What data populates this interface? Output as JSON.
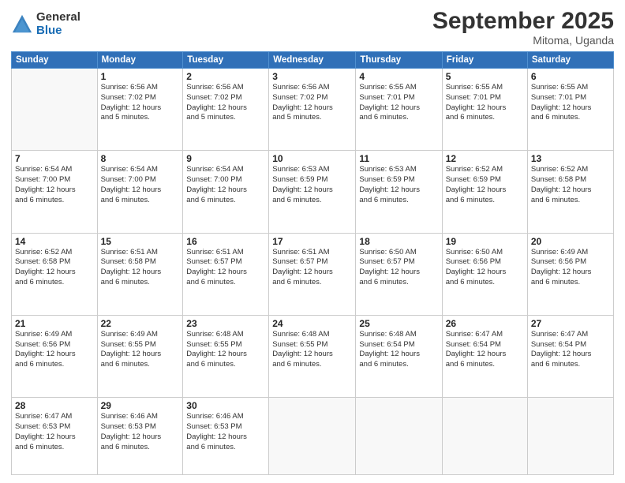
{
  "logo": {
    "general": "General",
    "blue": "Blue"
  },
  "header": {
    "month": "September 2025",
    "location": "Mitoma, Uganda"
  },
  "days_of_week": [
    "Sunday",
    "Monday",
    "Tuesday",
    "Wednesday",
    "Thursday",
    "Friday",
    "Saturday"
  ],
  "weeks": [
    [
      {
        "num": "",
        "info": ""
      },
      {
        "num": "1",
        "info": "Sunrise: 6:56 AM\nSunset: 7:02 PM\nDaylight: 12 hours\nand 5 minutes."
      },
      {
        "num": "2",
        "info": "Sunrise: 6:56 AM\nSunset: 7:02 PM\nDaylight: 12 hours\nand 5 minutes."
      },
      {
        "num": "3",
        "info": "Sunrise: 6:56 AM\nSunset: 7:02 PM\nDaylight: 12 hours\nand 5 minutes."
      },
      {
        "num": "4",
        "info": "Sunrise: 6:55 AM\nSunset: 7:01 PM\nDaylight: 12 hours\nand 6 minutes."
      },
      {
        "num": "5",
        "info": "Sunrise: 6:55 AM\nSunset: 7:01 PM\nDaylight: 12 hours\nand 6 minutes."
      },
      {
        "num": "6",
        "info": "Sunrise: 6:55 AM\nSunset: 7:01 PM\nDaylight: 12 hours\nand 6 minutes."
      }
    ],
    [
      {
        "num": "7",
        "info": "Sunrise: 6:54 AM\nSunset: 7:00 PM\nDaylight: 12 hours\nand 6 minutes."
      },
      {
        "num": "8",
        "info": "Sunrise: 6:54 AM\nSunset: 7:00 PM\nDaylight: 12 hours\nand 6 minutes."
      },
      {
        "num": "9",
        "info": "Sunrise: 6:54 AM\nSunset: 7:00 PM\nDaylight: 12 hours\nand 6 minutes."
      },
      {
        "num": "10",
        "info": "Sunrise: 6:53 AM\nSunset: 6:59 PM\nDaylight: 12 hours\nand 6 minutes."
      },
      {
        "num": "11",
        "info": "Sunrise: 6:53 AM\nSunset: 6:59 PM\nDaylight: 12 hours\nand 6 minutes."
      },
      {
        "num": "12",
        "info": "Sunrise: 6:52 AM\nSunset: 6:59 PM\nDaylight: 12 hours\nand 6 minutes."
      },
      {
        "num": "13",
        "info": "Sunrise: 6:52 AM\nSunset: 6:58 PM\nDaylight: 12 hours\nand 6 minutes."
      }
    ],
    [
      {
        "num": "14",
        "info": "Sunrise: 6:52 AM\nSunset: 6:58 PM\nDaylight: 12 hours\nand 6 minutes."
      },
      {
        "num": "15",
        "info": "Sunrise: 6:51 AM\nSunset: 6:58 PM\nDaylight: 12 hours\nand 6 minutes."
      },
      {
        "num": "16",
        "info": "Sunrise: 6:51 AM\nSunset: 6:57 PM\nDaylight: 12 hours\nand 6 minutes."
      },
      {
        "num": "17",
        "info": "Sunrise: 6:51 AM\nSunset: 6:57 PM\nDaylight: 12 hours\nand 6 minutes."
      },
      {
        "num": "18",
        "info": "Sunrise: 6:50 AM\nSunset: 6:57 PM\nDaylight: 12 hours\nand 6 minutes."
      },
      {
        "num": "19",
        "info": "Sunrise: 6:50 AM\nSunset: 6:56 PM\nDaylight: 12 hours\nand 6 minutes."
      },
      {
        "num": "20",
        "info": "Sunrise: 6:49 AM\nSunset: 6:56 PM\nDaylight: 12 hours\nand 6 minutes."
      }
    ],
    [
      {
        "num": "21",
        "info": "Sunrise: 6:49 AM\nSunset: 6:56 PM\nDaylight: 12 hours\nand 6 minutes."
      },
      {
        "num": "22",
        "info": "Sunrise: 6:49 AM\nSunset: 6:55 PM\nDaylight: 12 hours\nand 6 minutes."
      },
      {
        "num": "23",
        "info": "Sunrise: 6:48 AM\nSunset: 6:55 PM\nDaylight: 12 hours\nand 6 minutes."
      },
      {
        "num": "24",
        "info": "Sunrise: 6:48 AM\nSunset: 6:55 PM\nDaylight: 12 hours\nand 6 minutes."
      },
      {
        "num": "25",
        "info": "Sunrise: 6:48 AM\nSunset: 6:54 PM\nDaylight: 12 hours\nand 6 minutes."
      },
      {
        "num": "26",
        "info": "Sunrise: 6:47 AM\nSunset: 6:54 PM\nDaylight: 12 hours\nand 6 minutes."
      },
      {
        "num": "27",
        "info": "Sunrise: 6:47 AM\nSunset: 6:54 PM\nDaylight: 12 hours\nand 6 minutes."
      }
    ],
    [
      {
        "num": "28",
        "info": "Sunrise: 6:47 AM\nSunset: 6:53 PM\nDaylight: 12 hours\nand 6 minutes."
      },
      {
        "num": "29",
        "info": "Sunrise: 6:46 AM\nSunset: 6:53 PM\nDaylight: 12 hours\nand 6 minutes."
      },
      {
        "num": "30",
        "info": "Sunrise: 6:46 AM\nSunset: 6:53 PM\nDaylight: 12 hours\nand 6 minutes."
      },
      {
        "num": "",
        "info": ""
      },
      {
        "num": "",
        "info": ""
      },
      {
        "num": "",
        "info": ""
      },
      {
        "num": "",
        "info": ""
      }
    ]
  ]
}
